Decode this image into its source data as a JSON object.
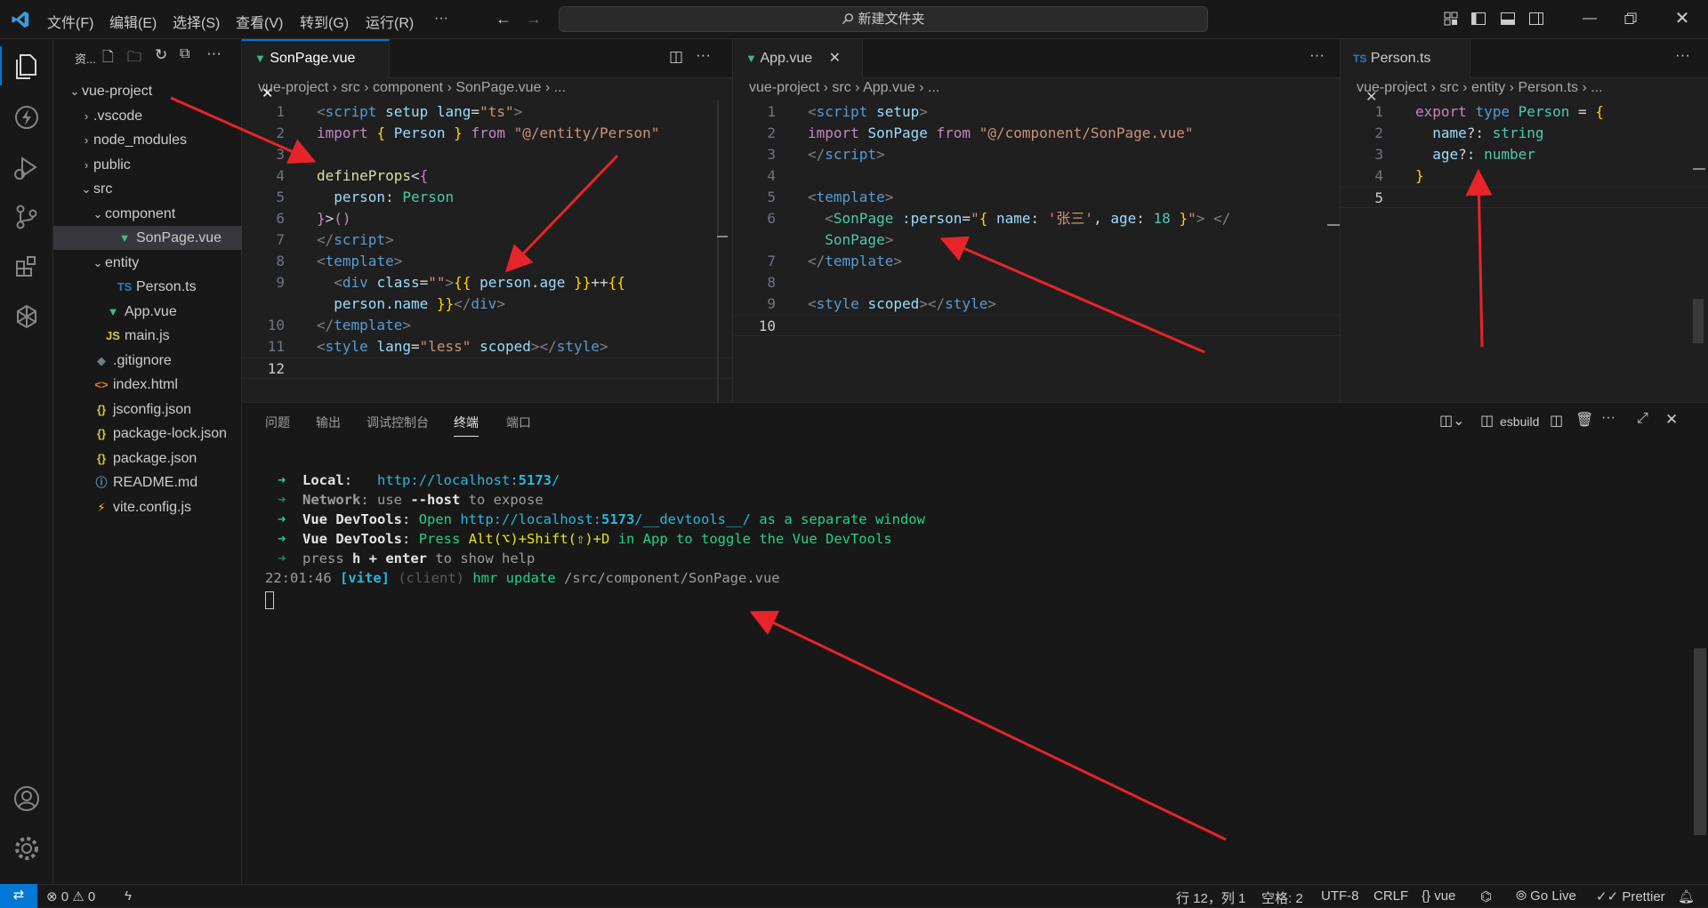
{
  "titlebar": {
    "menus": [
      "文件(F)",
      "编辑(E)",
      "选择(S)",
      "查看(V)",
      "转到(G)",
      "运行(R)",
      "···"
    ],
    "search": "新建文件夹"
  },
  "explorer": {
    "header": "资...",
    "items": [
      {
        "label": "vue-project",
        "indent": 0,
        "chev": "open",
        "icon": ""
      },
      {
        "label": ".vscode",
        "indent": 1,
        "chev": "closed",
        "icon": ""
      },
      {
        "label": "node_modules",
        "indent": 1,
        "chev": "closed",
        "icon": ""
      },
      {
        "label": "public",
        "indent": 1,
        "chev": "closed",
        "icon": ""
      },
      {
        "label": "src",
        "indent": 1,
        "chev": "open",
        "icon": ""
      },
      {
        "label": "component",
        "indent": 2,
        "chev": "open",
        "icon": ""
      },
      {
        "label": "SonPage.vue",
        "indent": 3,
        "chev": "",
        "icon": "vue",
        "selected": true
      },
      {
        "label": "entity",
        "indent": 2,
        "chev": "open",
        "icon": ""
      },
      {
        "label": "Person.ts",
        "indent": 3,
        "chev": "",
        "icon": "ts"
      },
      {
        "label": "App.vue",
        "indent": 2,
        "chev": "",
        "icon": "vue"
      },
      {
        "label": "main.js",
        "indent": 2,
        "chev": "",
        "icon": "js"
      },
      {
        "label": ".gitignore",
        "indent": 1,
        "chev": "",
        "icon": "git"
      },
      {
        "label": "index.html",
        "indent": 1,
        "chev": "",
        "icon": "html"
      },
      {
        "label": "jsconfig.json",
        "indent": 1,
        "chev": "",
        "icon": "json"
      },
      {
        "label": "package-lock.json",
        "indent": 1,
        "chev": "",
        "icon": "json"
      },
      {
        "label": "package.json",
        "indent": 1,
        "chev": "",
        "icon": "json"
      },
      {
        "label": "README.md",
        "indent": 1,
        "chev": "",
        "icon": "info"
      },
      {
        "label": "vite.config.js",
        "indent": 1,
        "chev": "",
        "icon": "vite"
      }
    ]
  },
  "editors": [
    {
      "tab": "SonPage.vue",
      "breadcrumb": [
        "vue-project",
        "src",
        "component",
        "SonPage.vue",
        "..."
      ],
      "lines": [
        {
          "n": "1",
          "html": "<span class='t'>&lt;</span><span class='k'>script</span> <span class='v'>setup</span> <span class='v'>lang</span><span class='w'>=</span><span class='s'>\"ts\"</span><span class='t'>&gt;</span>"
        },
        {
          "n": "2",
          "html": "<span class='p'>import</span> <span class='y'>{</span> <span class='v'>Person</span> <span class='y'>}</span> <span class='p'>from</span> <span class='s'>\"@/entity/Person\"</span>"
        },
        {
          "n": "3",
          "html": ""
        },
        {
          "n": "4",
          "html": "<span class='f'>defineProps</span><span class='w'>&lt;</span><span class='p'>{</span>"
        },
        {
          "n": "5",
          "html": "  <span class='v'>person</span><span class='w'>:</span> <span class='c'>Person</span>"
        },
        {
          "n": "6",
          "html": "<span class='p'>}</span><span class='w'>&gt;</span><span class='p'>()</span>"
        },
        {
          "n": "7",
          "html": "<span class='t'>&lt;/</span><span class='k'>script</span><span class='t'>&gt;</span>"
        },
        {
          "n": "8",
          "html": "<span class='t'>&lt;</span><span class='k'>template</span><span class='t'>&gt;</span>"
        },
        {
          "n": "9",
          "html": "  <span class='t'>&lt;</span><span class='k'>div</span> <span class='v'>class</span><span class='w'>=</span><span class='s'>\"\"</span><span class='t'>&gt;</span><span class='y'>{{</span> <span class='v'>person</span><span class='w'>.</span><span class='v'>age</span> <span class='y'>}}</span><span class='w'>++</span><span class='y'>{{</span>"
        },
        {
          "n": "",
          "html": "  <span class='v'>person</span><span class='w'>.</span><span class='v'>name</span> <span class='y'>}}</span><span class='t'>&lt;/</span><span class='k'>div</span><span class='t'>&gt;</span>"
        },
        {
          "n": "10",
          "html": "<span class='t'>&lt;/</span><span class='k'>template</span><span class='t'>&gt;</span>"
        },
        {
          "n": "11",
          "html": "<span class='t'>&lt;</span><span class='k'>style</span> <span class='v'>lang</span><span class='w'>=</span><span class='s'>\"less\"</span> <span class='v'>scoped</span><span class='t'>&gt;&lt;/</span><span class='k'>style</span><span class='t'>&gt;</span>"
        },
        {
          "n": "12",
          "html": "",
          "current": true
        }
      ]
    },
    {
      "tab": "App.vue",
      "breadcrumb": [
        "vue-project",
        "src",
        "App.vue",
        "..."
      ],
      "lines": [
        {
          "n": "1",
          "html": "<span class='t'>&lt;</span><span class='k'>script</span> <span class='v'>setup</span><span class='t'>&gt;</span>"
        },
        {
          "n": "2",
          "html": "<span class='p'>import</span> <span class='v'>SonPage</span> <span class='p'>from</span> <span class='s'>\"@/component/SonPage.vue\"</span>"
        },
        {
          "n": "3",
          "html": "<span class='t'>&lt;/</span><span class='k'>script</span><span class='t'>&gt;</span>"
        },
        {
          "n": "4",
          "html": ""
        },
        {
          "n": "5",
          "html": "<span class='t'>&lt;</span><span class='k'>template</span><span class='t'>&gt;</span>"
        },
        {
          "n": "6",
          "html": "  <span class='t'>&lt;</span><span class='c'>SonPage</span> <span class='v'>:person</span><span class='w'>=</span><span class='s'>\"</span><span class='y'>{</span> <span class='v'>name</span><span class='w'>:</span> <span class='s'>'张三'</span><span class='w'>,</span> <span class='v'>age</span><span class='w'>:</span> <span class='g'>18</span> <span class='y'>}</span><span class='s'>\"</span><span class='t'>&gt;</span> <span class='t'>&lt;/</span>"
        },
        {
          "n": "",
          "html": "  <span class='c'>SonPage</span><span class='t'>&gt;</span>"
        },
        {
          "n": "7",
          "html": "<span class='t'>&lt;/</span><span class='k'>template</span><span class='t'>&gt;</span>"
        },
        {
          "n": "8",
          "html": ""
        },
        {
          "n": "9",
          "html": "<span class='t'>&lt;</span><span class='k'>style</span> <span class='v'>scoped</span><span class='t'>&gt;&lt;/</span><span class='k'>style</span><span class='t'>&gt;</span>"
        },
        {
          "n": "10",
          "html": "",
          "current": true
        }
      ]
    },
    {
      "tab": "Person.ts",
      "breadcrumb": [
        "vue-project",
        "src",
        "entity",
        "Person.ts",
        "..."
      ],
      "lines": [
        {
          "n": "1",
          "html": "<span class='p'>export</span> <span class='k'>type</span> <span class='c'>Person</span> <span class='w'>=</span> <span class='y'>{</span>"
        },
        {
          "n": "2",
          "html": "  <span class='v'>name</span><span class='w'>?:</span> <span class='c'>string</span>"
        },
        {
          "n": "3",
          "html": "  <span class='v'>age</span><span class='w'>?:</span> <span class='c'>number</span>"
        },
        {
          "n": "4",
          "html": "<span class='y'>}</span>"
        },
        {
          "n": "5",
          "html": "",
          "current": true
        }
      ]
    }
  ],
  "panel": {
    "tabs": [
      "问题",
      "输出",
      "调试控制台",
      "终端",
      "端口"
    ],
    "active_tab": "终端",
    "terminal_name": "esbuild",
    "lines": [
      "<span class='arr'>➜</span>  <b style='color:#e5e5e5'>Local</b><span style='color:#e5e5e5'>:</span>   <span style='color:#29b8db'>http://localhost:<b>5173</b>/</span>",
      "<span class='arr' style='opacity:.6'>➜</span>  <b style='color:#9d9d9d'>Network</b><span style='color:#9d9d9d'>: use </span><b style='color:#e5e5e5'>--host</b><span style='color:#9d9d9d'> to expose</span>",
      "<span class='arr'>➜</span>  <b style='color:#e5e5e5'>Vue DevTools</b><span style='color:#e5e5e5'>:</span> <span style='color:#23d18b'>Open</span> <span style='color:#29b8db'>http://localhost:<b>5173</b>/__devtools__/</span> <span style='color:#23d18b'>as a separate window</span>",
      "<span class='arr'>➜</span>  <b style='color:#e5e5e5'>Vue DevTools</b><span style='color:#e5e5e5'>:</span> <span style='color:#23d18b'>Press</span> <span style='color:#e5e510'>Alt(⌥)+Shift(⇧)+D</span> <span style='color:#23d18b'>in App to toggle the Vue DevTools</span>",
      "<span class='arr' style='opacity:.6'>➜</span>  <span style='color:#9d9d9d'>press </span><b style='color:#e5e5e5'>h + enter</b><span style='color:#9d9d9d'> to show help</span>",
      "<span style='color:#9d9d9d'>22:01:46</span> <b style='color:#29b8db'>[vite]</b> <span style='color:#5a5a5a'>(client)</span> <span style='color:#23d18b'>hmr update</span> <span style='color:#9d9d9d'>/src/component/SonPage.vue</span>"
    ]
  },
  "statusbar": {
    "errors": "0",
    "warnings": "0",
    "position": "行 12，列 1",
    "spaces": "空格: 2",
    "encoding": "UTF-8",
    "eol": "CRLF",
    "language": "vue",
    "golive": "Go Live",
    "prettier": "Prettier"
  }
}
